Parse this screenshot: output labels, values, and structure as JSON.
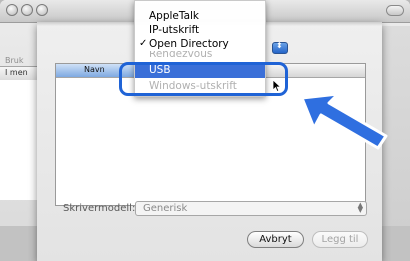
{
  "background_window": {
    "label_fragment": "Bruk",
    "column_fragment": "I men"
  },
  "menu": {
    "items": [
      {
        "label": "AppleTalk",
        "checked": false
      },
      {
        "label": "IP-utskrift",
        "checked": false
      },
      {
        "label": "Open Directory",
        "checked": true,
        "check_glyph": "✓"
      },
      {
        "label": "Rendezvous",
        "checked": false
      },
      {
        "label": "USB",
        "checked": false,
        "selected": true
      },
      {
        "label": "Windows-utskrift",
        "checked": false
      }
    ]
  },
  "list": {
    "column_name": "Navn"
  },
  "model": {
    "label": "Skrivermodell:",
    "value": "Generisk"
  },
  "buttons": {
    "cancel": "Avbryt",
    "add": "Legg til"
  },
  "colors": {
    "highlight": "#1f63d6",
    "selection": "#3a6fd8",
    "arrow": "#2f6fe0"
  },
  "icons": {
    "arrow": "big-arrow-icon",
    "pointer": "mouse-pointer-icon"
  }
}
